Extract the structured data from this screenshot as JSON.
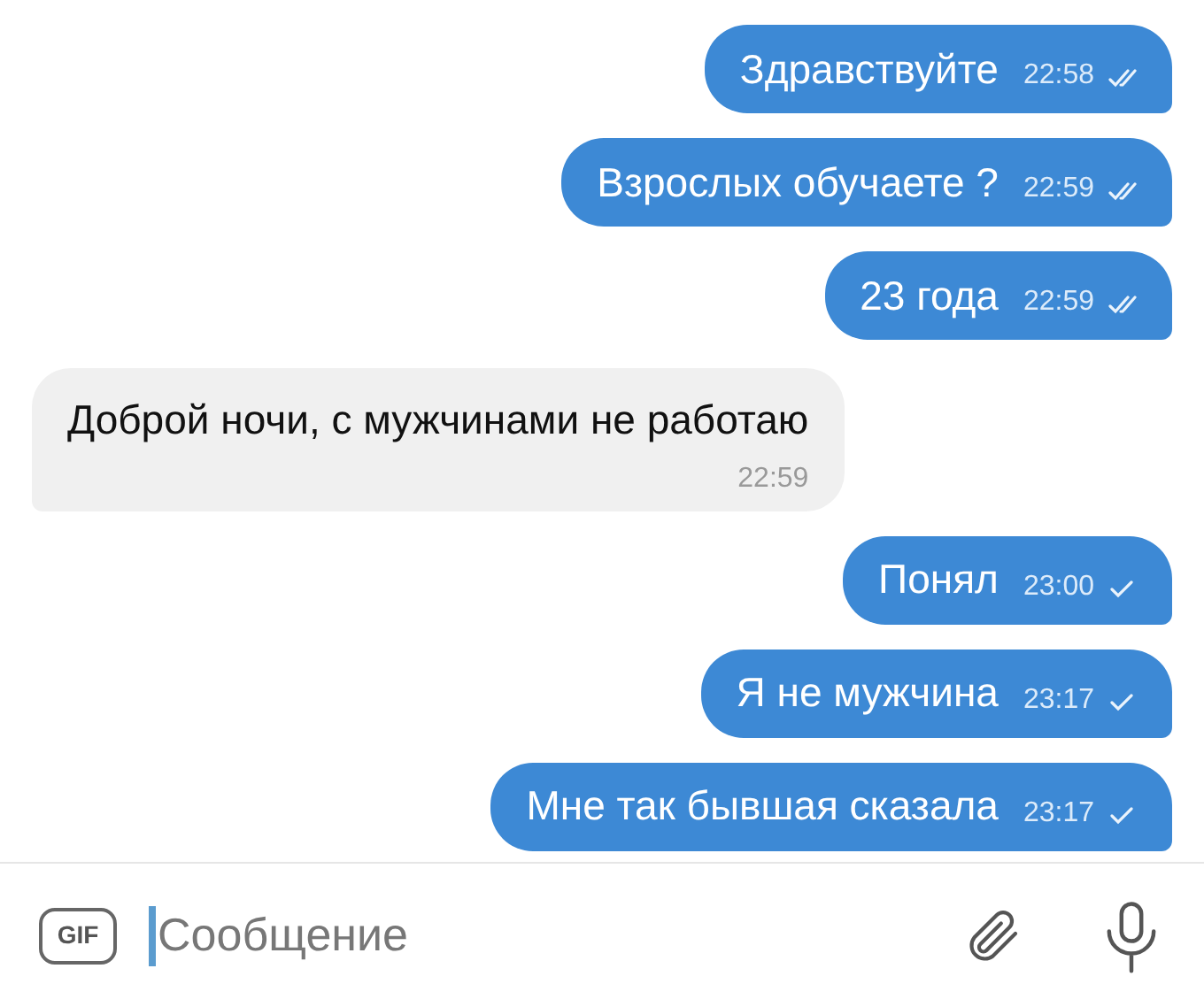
{
  "messages": [
    {
      "kind": "outgoing",
      "text": "Здравствуйте",
      "time": "22:58",
      "read": true
    },
    {
      "kind": "outgoing",
      "text": "Взрослых обучаете ?",
      "time": "22:59",
      "read": true
    },
    {
      "kind": "outgoing",
      "text": "23 года",
      "time": "22:59",
      "read": true
    },
    {
      "kind": "incoming",
      "text": "Доброй ночи, с мужчинами не работаю",
      "time": "22:59"
    },
    {
      "kind": "outgoing",
      "text": "Понял",
      "time": "23:00",
      "read": false
    },
    {
      "kind": "outgoing",
      "text": "Я не мужчина",
      "time": "23:17",
      "read": false
    },
    {
      "kind": "outgoing",
      "text": "Мне так бывшая сказала",
      "time": "23:17",
      "read": false
    }
  ],
  "composer": {
    "gif_label": "GIF",
    "placeholder": "Сообщение"
  }
}
